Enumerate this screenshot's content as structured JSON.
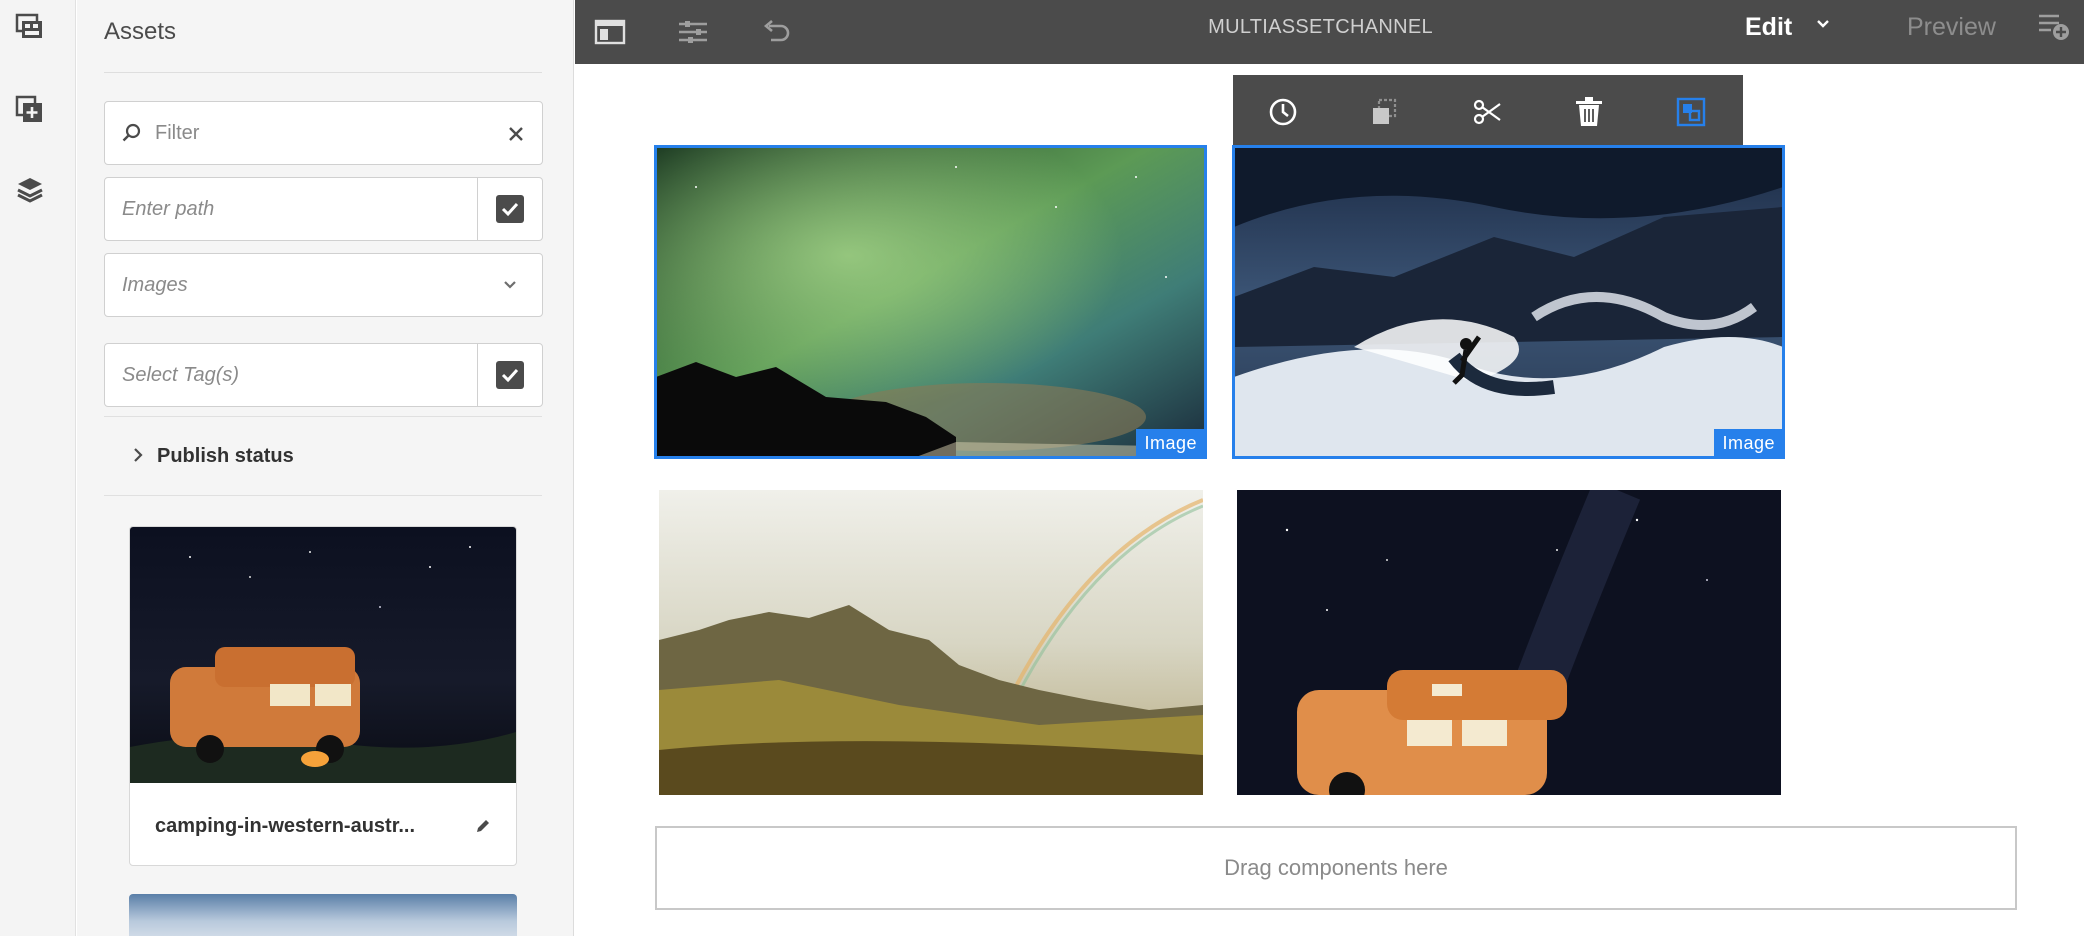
{
  "rail": {
    "items": [
      "asset-finder",
      "components",
      "content-tree"
    ]
  },
  "panel": {
    "title": "Assets",
    "filter_placeholder": "Filter",
    "path_placeholder": "Enter path",
    "type_select_value": "Images",
    "tags_placeholder": "Select Tag(s)",
    "publish_status_label": "Publish status",
    "asset_card": {
      "name": "camping-in-western-austr..."
    }
  },
  "topbar": {
    "title": "MULTIASSETCHANNEL",
    "mode_label": "Edit",
    "preview_label": "Preview"
  },
  "canvas": {
    "images": [
      {
        "name": "aurora",
        "badge": "Image",
        "selected": true
      },
      {
        "name": "surfer",
        "badge": "Image",
        "selected": true
      },
      {
        "name": "rainbow-mountains",
        "badge": "",
        "selected": false
      },
      {
        "name": "camper-van-night",
        "badge": "",
        "selected": false
      }
    ],
    "dropzone_label": "Drag components here"
  },
  "colors": {
    "accent": "#2680eb",
    "topbar": "#4b4b4b",
    "panel_bg": "#f5f5f5"
  }
}
